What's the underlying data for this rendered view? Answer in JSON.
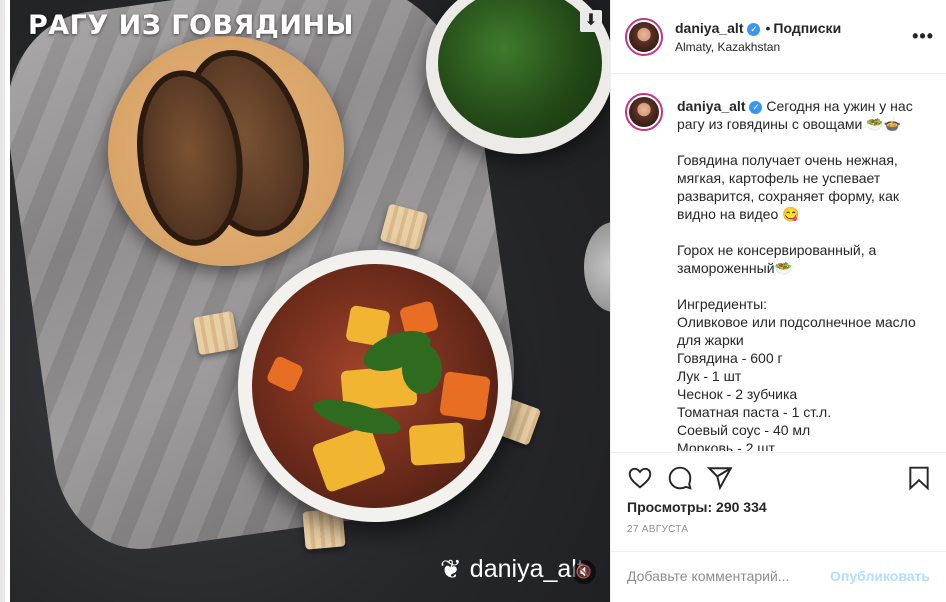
{
  "media": {
    "title_overlay": "РАГУ ИЗ ГОВЯДИНЫ",
    "watermark": "daniya_alt",
    "save_icon": "download-arrow-icon",
    "mute_icon": "muted-speaker-icon"
  },
  "post": {
    "username": "daniya_alt",
    "follow_label": "Подписки",
    "location": "Almaty, Kazakhstan",
    "more_label": "•••"
  },
  "caption": {
    "username": "daniya_alt",
    "intro": "Сегодня на ужин у нас рагу из говядины с овощами 🥗🍲",
    "paragraph2": "Говядина получает очень нежная, мягкая, картофель не успевает разварится, сохраняет форму, как видно на видео 😋",
    "paragraph3": "Горох не консервированный, а замороженный🥗",
    "ingredients_title": "Ингредиенты:",
    "ingredients": [
      "Оливковое или подсолнечное масло для жарки",
      "Говядина - 600 г",
      "Лук - 1 шт",
      "Чеснок - 2 зубчика",
      "Томатная паста - 1 ст.л.",
      "Соевый соус - 40 мл",
      "Морковь - 2 шт"
    ]
  },
  "actions": {
    "views_label": "Просмотры: 290 334",
    "date": "27 АВГУСТА"
  },
  "comment": {
    "placeholder": "Добавьте комментарий...",
    "post_label": "Опубликовать"
  },
  "colors": {
    "verified": "#3897f0",
    "post_button_disabled": "#b2dffc",
    "avatar_ring": "#c13584"
  }
}
